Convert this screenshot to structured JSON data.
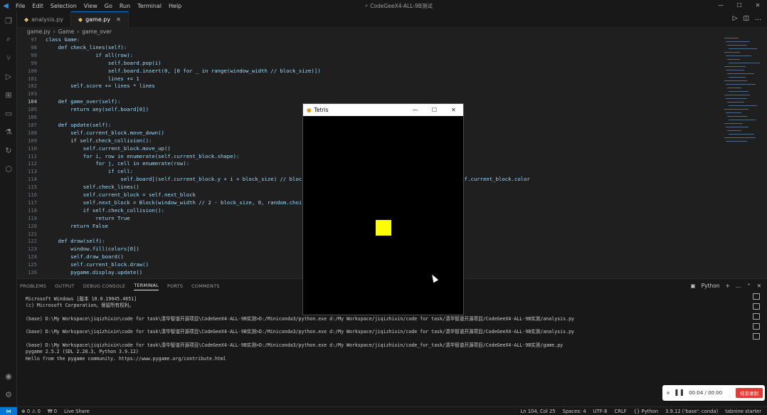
{
  "titlebar": {
    "menu": [
      "File",
      "Edit",
      "Selection",
      "View",
      "Go",
      "Run",
      "Terminal",
      "Help"
    ],
    "command_center": "CodeGeeX4-ALL-9B测试",
    "controls": [
      "—",
      "☐",
      "✕"
    ]
  },
  "activity_icons": [
    "files-icon",
    "search-icon",
    "source-control-icon",
    "run-debug-icon",
    "extensions-icon",
    "remote-explorer-icon",
    "testing-icon",
    "liveshare-icon",
    "codegeex-icon"
  ],
  "tabs": [
    {
      "label": "analysis.py",
      "active": false
    },
    {
      "label": "game.py",
      "active": true
    }
  ],
  "breadcrumb": [
    "game.py",
    "Game",
    "game_over"
  ],
  "editor": {
    "lines": [
      {
        "n": "97",
        "text": "class Game:"
      },
      {
        "n": "98",
        "text": "    def check_lines(self):"
      },
      {
        "n": "99",
        "text": "                if all(row):"
      },
      {
        "n": "99",
        "text": "                    self.board.pop(i)"
      },
      {
        "n": "100",
        "text": "                    self.board.insert(0, [0 for _ in range(window_width // block_size)])"
      },
      {
        "n": "101",
        "text": "                    lines += 1"
      },
      {
        "n": "102",
        "text": "        self.score += lines * lines"
      },
      {
        "n": "103",
        "text": ""
      },
      {
        "n": "104",
        "text": "    def game_over(self):"
      },
      {
        "n": "105",
        "text": "        return any(self.board[0])"
      },
      {
        "n": "106",
        "text": ""
      },
      {
        "n": "107",
        "text": "    def update(self):"
      },
      {
        "n": "108",
        "text": "        self.current_block.move_down()"
      },
      {
        "n": "109",
        "text": "        if self.check_collision():"
      },
      {
        "n": "110",
        "text": "            self.current_block.move_up()"
      },
      {
        "n": "111",
        "text": "            for i, row in enumerate(self.current_block.shape):"
      },
      {
        "n": "112",
        "text": "                for j, cell in enumerate(row):"
      },
      {
        "n": "113",
        "text": "                    if cell:"
      },
      {
        "n": "114",
        "text": "                        self.board[(self.current_block.y + i + block_size) // block_                                    ck_size] = self.current_block.color"
      },
      {
        "n": "115",
        "text": "            self.check_lines()"
      },
      {
        "n": "116",
        "text": "            self.current_block = self.next_block"
      },
      {
        "n": "117",
        "text": "            self.next_block = Block(window_width // 2 - block_size, 0, random.choic"
      },
      {
        "n": "118",
        "text": "            if self.check_collision():"
      },
      {
        "n": "119",
        "text": "                return True"
      },
      {
        "n": "120",
        "text": "        return False"
      },
      {
        "n": "121",
        "text": ""
      },
      {
        "n": "122",
        "text": "    def draw(self):"
      },
      {
        "n": "123",
        "text": "        window.fill(colors[0])"
      },
      {
        "n": "124",
        "text": "        self.draw_board()"
      },
      {
        "n": "125",
        "text": "        self.current_block.draw()"
      },
      {
        "n": "126",
        "text": "        pygame.display.update()"
      },
      {
        "n": "127",
        "text": ""
      }
    ],
    "current_line": "104"
  },
  "panel": {
    "tabs": [
      "PROBLEMS",
      "OUTPUT",
      "DEBUG CONSOLE",
      "TERMINAL",
      "PORTS",
      "COMMENTS"
    ],
    "active_tab": "TERMINAL",
    "shell_label": "Python",
    "terminal_lines": [
      "Microsoft Windows [版本 10.0.19045.4651]",
      "(c) Microsoft Corporation。保留所有权利。",
      "",
      "(base) D:\\My Workspace\\jiqizhixin\\code for task\\清华智谱开源项目\\CodeGeeX4-ALL-9B实测>D:/Miniconda3/python.exe d:/My Workspace/jiqizhixin/code for task/清华智谱开源项目/CodeGeeX4-ALL-9B实测/analysis.py",
      "",
      "(base) D:\\My Workspace\\jiqizhixin\\code for task\\清华智谱开源项目\\CodeGeeX4-ALL-9B实测>D:/Miniconda3/python.exe d:/My Workspace/jiqizhixin/code for task/清华智谱开源项目/CodeGeeX4-ALL-9B实测/analysis.py",
      "",
      "(base) D:\\My Workspace\\jiqizhixin\\code for task\\清华智谱开源项目\\CodeGeeX4-ALL-9B实测>D:/Miniconda3/python.exe d:/My Workspace/jiqizhixin/code_for_task/清华智谱开源项目/CodeGeeX4-ALL-9B实测/game.py",
      "pygame 2.5.2 (SDL 2.28.3, Python 3.9.12)",
      "Hello from the pygame community. https://www.pygame.org/contribute.html"
    ]
  },
  "statusbar": {
    "left": [
      "⊗ 0 ⚠ 0",
      "₩ 0",
      "Live Share"
    ],
    "right": [
      "Ln 104, Col 25",
      "Spaces: 4",
      "UTF-8",
      "CRLF",
      "{} Python",
      "3.9.12 ('base': conda)",
      "tabnine starter"
    ]
  },
  "tetris_window": {
    "title": "Tetris",
    "block_color": "#ffff00"
  },
  "recorder": {
    "time": "00:04 / 00:00",
    "stop_label": "结束录制"
  },
  "colors": {
    "accent": "#0078d4",
    "editor_bg": "#1f1f1f",
    "panel_bg": "#181818"
  }
}
